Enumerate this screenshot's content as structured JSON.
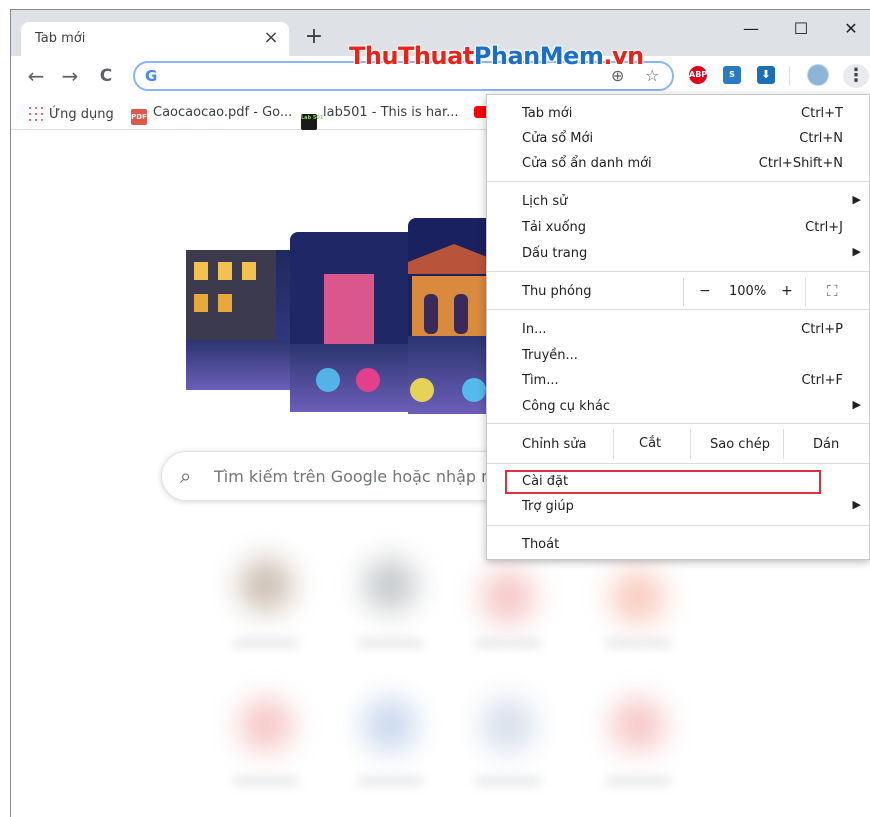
{
  "tab": {
    "title": "Tab mới",
    "close": "×",
    "new_tab": "+"
  },
  "watermark": {
    "part1": "ThuThuat",
    "part2": "PhanMem",
    "part3": ".vn"
  },
  "window": {
    "minimize": "—",
    "maximize": "☐",
    "close": "✕"
  },
  "toolbar": {
    "back": "←",
    "forward": "→",
    "reload": "C",
    "address_value": "",
    "g_logo": "G",
    "translate_icon": "⊕",
    "star_icon": "☆",
    "menu_icon": "⋮"
  },
  "extensions": [
    {
      "name": "ABP",
      "color": "#e2001a"
    },
    {
      "name": "S",
      "color": "#2b7bc1"
    },
    {
      "name": "⬇",
      "color": "#1a6fb5"
    }
  ],
  "bookmarks": [
    {
      "label": "Ứng dụng",
      "icon": "apps-grid-icon"
    },
    {
      "label": "Caocaocao.pdf - Go...",
      "icon": "pdf-icon",
      "badge": "PDF"
    },
    {
      "label": "lab501 - This is har...",
      "icon": "lab501-icon",
      "badge": "Lab 501"
    }
  ],
  "search": {
    "placeholder": "Tìm kiếm trên Google hoặc nhập n"
  },
  "menu": {
    "new_tab": {
      "label": "Tab mới",
      "shortcut": "Ctrl+T"
    },
    "new_window": {
      "label": "Cửa sổ Mới",
      "shortcut": "Ctrl+N"
    },
    "incognito": {
      "label": "Cửa sổ ẩn danh mới",
      "shortcut": "Ctrl+Shift+N"
    },
    "history": {
      "label": "Lịch sử",
      "arrow": "▶"
    },
    "downloads": {
      "label": "Tải xuống",
      "shortcut": "Ctrl+J"
    },
    "bookmarks": {
      "label": "Dấu trang",
      "arrow": "▶"
    },
    "zoom": {
      "label": "Thu phóng",
      "minus": "−",
      "value": "100%",
      "plus": "+",
      "fullscreen": "⛶"
    },
    "print": {
      "label": "In...",
      "shortcut": "Ctrl+P"
    },
    "cast": {
      "label": "Truyền..."
    },
    "find": {
      "label": "Tìm...",
      "shortcut": "Ctrl+F"
    },
    "more_tools": {
      "label": "Công cụ khác",
      "arrow": "▶"
    },
    "edit": {
      "label": "Chỉnh sửa",
      "cut": "Cắt",
      "copy": "Sao chép",
      "paste": "Dán"
    },
    "settings": {
      "label": "Cài đặt"
    },
    "help": {
      "label": "Trợ giúp",
      "arrow": "▶"
    },
    "exit": {
      "label": "Thoát"
    }
  },
  "colors": {
    "highlight": "#e0303f",
    "omnibox_focus": "#8ab4f8"
  }
}
